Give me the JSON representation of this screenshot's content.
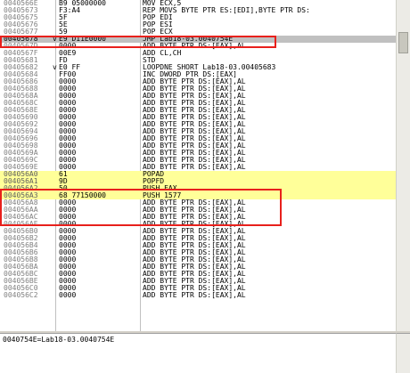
{
  "rows": [
    {
      "addr": "0040566E",
      "mark": "",
      "hex": "B9 05000000",
      "asm": "MOV ECX,5"
    },
    {
      "addr": "00405673",
      "mark": "",
      "hex": "F3:A4",
      "asm": "REP MOVS BYTE PTR ES:[EDI],BYTE PTR DS:"
    },
    {
      "addr": "00405675",
      "mark": "",
      "hex": "5F",
      "asm": "POP EDI"
    },
    {
      "addr": "00405676",
      "mark": "",
      "hex": "5E",
      "asm": "POP ESI"
    },
    {
      "addr": "00405677",
      "mark": "",
      "hex": "59",
      "asm": "POP ECX"
    },
    {
      "addr": "00405678",
      "mark": "v",
      "hex": "E9 D11E0000",
      "asm": "JMP Lab18-03.0040754E",
      "state": "sel"
    },
    {
      "addr": "0040567D",
      "mark": "",
      "hex": "0000",
      "asm": "ADD BYTE PTR DS:[EAX],AL"
    },
    {
      "addr": "0040567F",
      "mark": "",
      "hex": "00E9",
      "asm": "ADD CL,CH"
    },
    {
      "addr": "00405681",
      "mark": "",
      "hex": "FD",
      "asm": "STD"
    },
    {
      "addr": "00405682",
      "mark": "v",
      "hex": "E0 FF",
      "asm": "LOOPDNE SHORT Lab18-03.00405683"
    },
    {
      "addr": "00405684",
      "mark": "",
      "hex": "FF00",
      "asm": "INC DWORD PTR DS:[EAX]"
    },
    {
      "addr": "00405686",
      "mark": "",
      "hex": "0000",
      "asm": "ADD BYTE PTR DS:[EAX],AL"
    },
    {
      "addr": "00405688",
      "mark": "",
      "hex": "0000",
      "asm": "ADD BYTE PTR DS:[EAX],AL"
    },
    {
      "addr": "0040568A",
      "mark": "",
      "hex": "0000",
      "asm": "ADD BYTE PTR DS:[EAX],AL"
    },
    {
      "addr": "0040568C",
      "mark": "",
      "hex": "0000",
      "asm": "ADD BYTE PTR DS:[EAX],AL"
    },
    {
      "addr": "0040568E",
      "mark": "",
      "hex": "0000",
      "asm": "ADD BYTE PTR DS:[EAX],AL"
    },
    {
      "addr": "00405690",
      "mark": "",
      "hex": "0000",
      "asm": "ADD BYTE PTR DS:[EAX],AL"
    },
    {
      "addr": "00405692",
      "mark": "",
      "hex": "0000",
      "asm": "ADD BYTE PTR DS:[EAX],AL"
    },
    {
      "addr": "00405694",
      "mark": "",
      "hex": "0000",
      "asm": "ADD BYTE PTR DS:[EAX],AL"
    },
    {
      "addr": "00405696",
      "mark": "",
      "hex": "0000",
      "asm": "ADD BYTE PTR DS:[EAX],AL"
    },
    {
      "addr": "00405698",
      "mark": "",
      "hex": "0000",
      "asm": "ADD BYTE PTR DS:[EAX],AL"
    },
    {
      "addr": "0040569A",
      "mark": "",
      "hex": "0000",
      "asm": "ADD BYTE PTR DS:[EAX],AL"
    },
    {
      "addr": "0040569C",
      "mark": "",
      "hex": "0000",
      "asm": "ADD BYTE PTR DS:[EAX],AL"
    },
    {
      "addr": "0040569E",
      "mark": "",
      "hex": "0000",
      "asm": "ADD BYTE PTR DS:[EAX],AL"
    },
    {
      "addr": "004056A0",
      "mark": "",
      "hex": "61",
      "asm": "POPAD",
      "state": "hl"
    },
    {
      "addr": "004056A1",
      "mark": "",
      "hex": "9D",
      "asm": "POPFD",
      "state": "hl"
    },
    {
      "addr": "004056A2",
      "mark": "",
      "hex": "50",
      "asm": "PUSH EAX",
      "state": "hl"
    },
    {
      "addr": "004056A3",
      "mark": "",
      "hex": "68 77150000",
      "asm": "PUSH 1577",
      "state": "hl"
    },
    {
      "addr": "004056A8",
      "mark": "",
      "hex": "0000",
      "asm": "ADD BYTE PTR DS:[EAX],AL"
    },
    {
      "addr": "004056AA",
      "mark": "",
      "hex": "0000",
      "asm": "ADD BYTE PTR DS:[EAX],AL"
    },
    {
      "addr": "004056AC",
      "mark": "",
      "hex": "0000",
      "asm": "ADD BYTE PTR DS:[EAX],AL"
    },
    {
      "addr": "004056AE",
      "mark": "",
      "hex": "0000",
      "asm": "ADD BYTE PTR DS:[EAX],AL"
    },
    {
      "addr": "004056B0",
      "mark": "",
      "hex": "0000",
      "asm": "ADD BYTE PTR DS:[EAX],AL"
    },
    {
      "addr": "004056B2",
      "mark": "",
      "hex": "0000",
      "asm": "ADD BYTE PTR DS:[EAX],AL"
    },
    {
      "addr": "004056B4",
      "mark": "",
      "hex": "0000",
      "asm": "ADD BYTE PTR DS:[EAX],AL"
    },
    {
      "addr": "004056B6",
      "mark": "",
      "hex": "0000",
      "asm": "ADD BYTE PTR DS:[EAX],AL"
    },
    {
      "addr": "004056B8",
      "mark": "",
      "hex": "0000",
      "asm": "ADD BYTE PTR DS:[EAX],AL"
    },
    {
      "addr": "004056BA",
      "mark": "",
      "hex": "0000",
      "asm": "ADD BYTE PTR DS:[EAX],AL"
    },
    {
      "addr": "004056BC",
      "mark": "",
      "hex": "0000",
      "asm": "ADD BYTE PTR DS:[EAX],AL"
    },
    {
      "addr": "004056BE",
      "mark": "",
      "hex": "0000",
      "asm": "ADD BYTE PTR DS:[EAX],AL"
    },
    {
      "addr": "004056C0",
      "mark": "",
      "hex": "0000",
      "asm": "ADD BYTE PTR DS:[EAX],AL"
    },
    {
      "addr": "004056C2",
      "mark": "",
      "hex": "0000",
      "asm": "ADD BYTE PTR DS:[EAX],AL"
    }
  ],
  "info_pane": {
    "text": "0040754E=Lab18-03.0040754E"
  },
  "colors": {
    "selected_row": "#c0c0c0",
    "highlight_row": "#ffff99",
    "annotation_box": "#e8201c"
  }
}
